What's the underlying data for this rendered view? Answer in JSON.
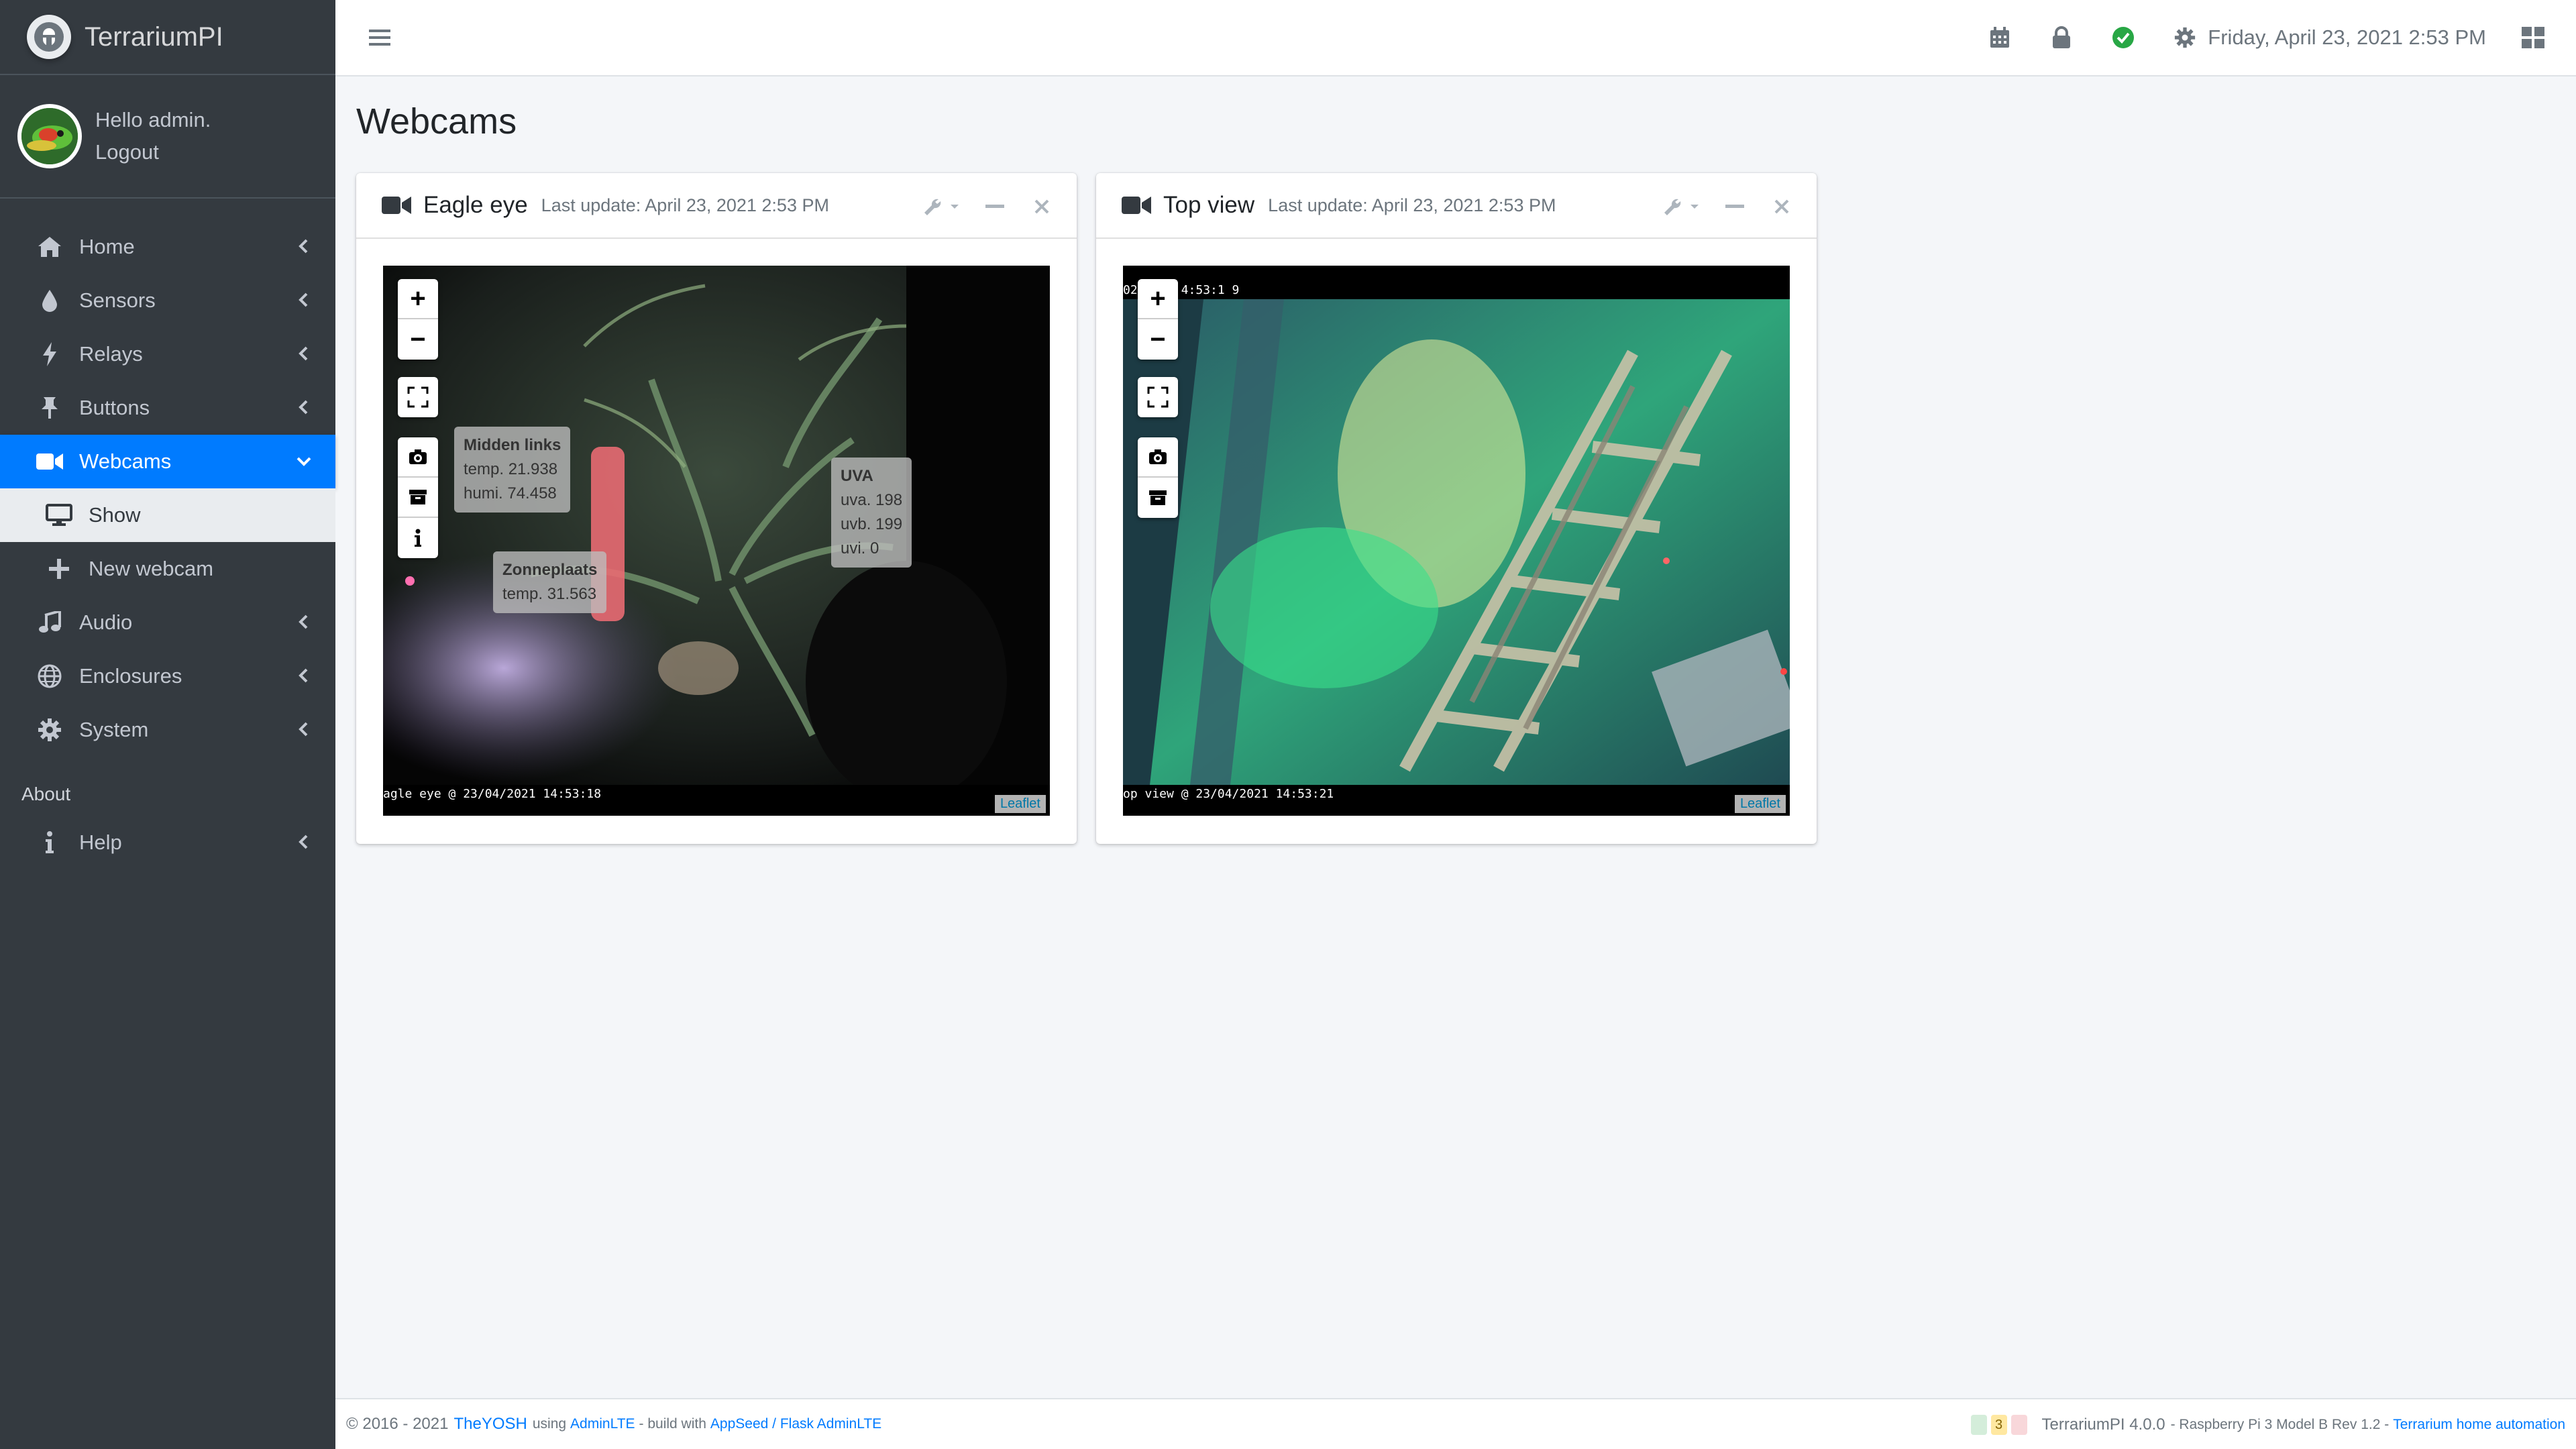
{
  "app": {
    "name": "TerrariumPI"
  },
  "user": {
    "greeting": "Hello admin.",
    "logout": "Logout"
  },
  "sidebar": {
    "items": [
      {
        "label": "Home",
        "icon": "home-icon"
      },
      {
        "label": "Sensors",
        "icon": "tint-icon"
      },
      {
        "label": "Relays",
        "icon": "bolt-icon"
      },
      {
        "label": "Buttons",
        "icon": "thumbtack-icon"
      },
      {
        "label": "Webcams",
        "icon": "video-icon"
      },
      {
        "label": "Audio",
        "icon": "music-icon"
      },
      {
        "label": "Enclosures",
        "icon": "globe-icon"
      },
      {
        "label": "System",
        "icon": "cog-icon"
      }
    ],
    "webcam_sub": [
      {
        "label": "Show",
        "icon": "desktop-icon"
      },
      {
        "label": "New webcam",
        "icon": "plus-icon"
      }
    ],
    "about_header": "About",
    "help": "Help"
  },
  "topbar": {
    "datetime": "Friday, April 23, 2021 2:53 PM"
  },
  "page": {
    "title": "Webcams"
  },
  "webcams": [
    {
      "name": "Eagle eye",
      "last_update": "Last update: April 23, 2021 2:53 PM",
      "overlay": "agle eye @ 23/04/2021 14:53:18",
      "attribution": "Leaflet",
      "markers": [
        {
          "title": "Midden links",
          "lines": [
            "temp. 21.938",
            "humi. 74.458"
          ]
        },
        {
          "title": "UVA",
          "lines": [
            "uva. 198",
            "uvb. 199",
            "uvi. 0"
          ]
        },
        {
          "title": "Zonneplaats",
          "lines": [
            "temp. 31.563"
          ]
        }
      ]
    },
    {
      "name": "Top view",
      "last_update": "Last update: April 23, 2021 2:53 PM",
      "top_overlay": "02   23 1 4:53:1 9",
      "overlay": "op view @ 23/04/2021 14:53:21",
      "attribution": "Leaflet"
    }
  ],
  "map_controls": {
    "zoom_in": "+",
    "zoom_out": "−"
  },
  "footer": {
    "copyright": "© 2016 - 2021",
    "author": "TheYOSH",
    "using": "using",
    "adminlte": "AdminLTE",
    "build_with": "- build with",
    "appseed": "AppSeed / Flask AdminLTE",
    "badge_count": "3",
    "version": "TerrariumPI 4.0.0",
    "hardware": "- Raspberry Pi 3 Model B Rev 1.2 -",
    "project_link": "Terrarium home automation"
  },
  "colors": {
    "primary": "#007bff",
    "sidebar": "#343a40",
    "success": "#28a745"
  }
}
